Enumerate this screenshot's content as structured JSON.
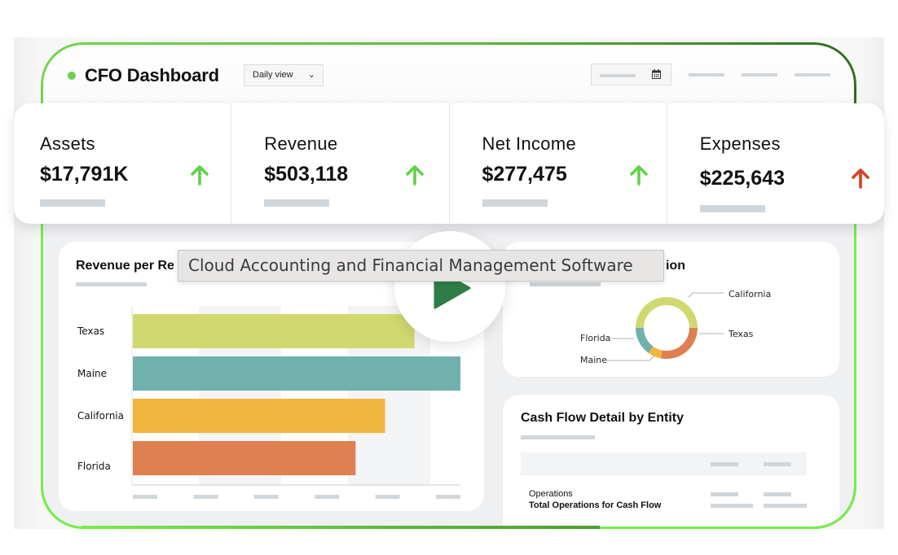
{
  "header": {
    "title": "CFO Dashboard",
    "view_select": {
      "selected": "Daily view"
    },
    "icons": {
      "dropdown": "chevron-down-icon",
      "date": "calendar-icon"
    },
    "accent_color": "#6ccf4f"
  },
  "kpis": [
    {
      "label": "Assets",
      "value": "$17,791K",
      "trend": "up",
      "trend_color": "#5fd14a"
    },
    {
      "label": "Revenue",
      "value": "$503,118",
      "trend": "up",
      "trend_color": "#5fd14a"
    },
    {
      "label": "Net Income",
      "value": "$277,475",
      "trend": "up",
      "trend_color": "#5fd14a"
    },
    {
      "label": "Expenses",
      "value": "$225,643",
      "trend": "up",
      "trend_color": "#d9401f"
    }
  ],
  "tooltip": {
    "text": "Cloud Accounting and Financial Management Software"
  },
  "play_button": {
    "icon": "play-icon",
    "color": "#2f7d46"
  },
  "revenue_card": {
    "title_visible": "Revenue per Re"
  },
  "distribution_card": {
    "title_visible": "ion"
  },
  "cash_flow": {
    "title": "Cash Flow Detail by Entity",
    "rows": [
      {
        "label": "Operations",
        "bold": false
      },
      {
        "label": "Total Operations for Cash Flow",
        "bold": true
      }
    ]
  },
  "chart_data": [
    {
      "type": "bar",
      "orientation": "horizontal",
      "title": "Revenue per Re",
      "categories": [
        "Texas",
        "Maine",
        "California",
        "Florida"
      ],
      "values": [
        86,
        100,
        77,
        68
      ],
      "value_units": "percent of largest bar",
      "colors": [
        "#d0d970",
        "#72b0ae",
        "#f0b640",
        "#de8050"
      ],
      "xlim": [
        0,
        100
      ],
      "x_tick_count": 6,
      "x_tick_labels": "placeholder",
      "grid": "alternating-bands"
    },
    {
      "type": "pie",
      "style": "donut",
      "title": "ion",
      "labels": [
        "California",
        "Texas",
        "Maine",
        "Florida"
      ],
      "values": [
        50,
        28,
        7,
        15
      ],
      "value_units": "percent",
      "colors": [
        "#d0d970",
        "#de8050",
        "#f0b640",
        "#72b0ae"
      ],
      "legend": "leader-line labels"
    }
  ]
}
